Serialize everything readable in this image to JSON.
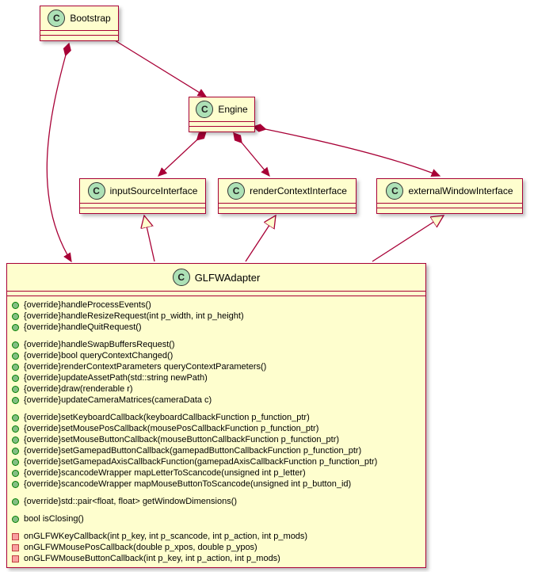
{
  "stereotype_letter": "C",
  "classes": {
    "bootstrap": {
      "name": "Bootstrap"
    },
    "engine": {
      "name": "Engine"
    },
    "inputSource": {
      "name": "inputSourceInterface"
    },
    "renderContext": {
      "name": "renderContextInterface"
    },
    "externalWindow": {
      "name": "externalWindowInterface"
    },
    "glfw": {
      "name": "GLFWAdapter",
      "groups": [
        [
          "{override}handleProcessEvents()",
          "{override}handleResizeRequest(int p_width, int p_height)",
          "{override}handleQuitRequest()"
        ],
        [
          "{override}handleSwapBuffersRequest()",
          "{override}bool queryContextChanged()",
          "{override}renderContextParameters queryContextParameters()",
          "{override}updateAssetPath(std::string newPath)",
          "{override}draw(renderable r)",
          "{override}updateCameraMatrices(cameraData c)"
        ],
        [
          "{override}setKeyboardCallback(keyboardCallbackFunction p_function_ptr)",
          "{override}setMousePosCallback(mousePosCallbackFunction p_function_ptr)",
          "{override}setMouseButtonCallback(mouseButtonCallbackFunction p_function_ptr)",
          "{override}setGamepadButtonCallback(gamepadButtonCallbackFunction p_function_ptr)",
          "{override}setGamepadAxisCallbackFunction(gamepadAxisCallbackFunction p_function_ptr)",
          "{override}scancodeWrapper mapLetterToScancode(unsigned int p_letter)",
          "{override}scancodeWrapper mapMouseButtonToScancode(unsigned int p_button_id)"
        ],
        [
          "{override}std::pair<float, float> getWindowDimensions()"
        ],
        [
          "bool isClosing()"
        ]
      ],
      "private_group": [
        "onGLFWKeyCallback(int p_key, int p_scancode, int p_action, int p_mods)",
        "onGLFWMousePosCallback(double p_xpos, double p_ypos)",
        "onGLFWMouseButtonCallback(int p_key, int p_action, int p_mods)"
      ]
    }
  },
  "colors": {
    "border": "#a80036",
    "fill": "#fefece"
  }
}
